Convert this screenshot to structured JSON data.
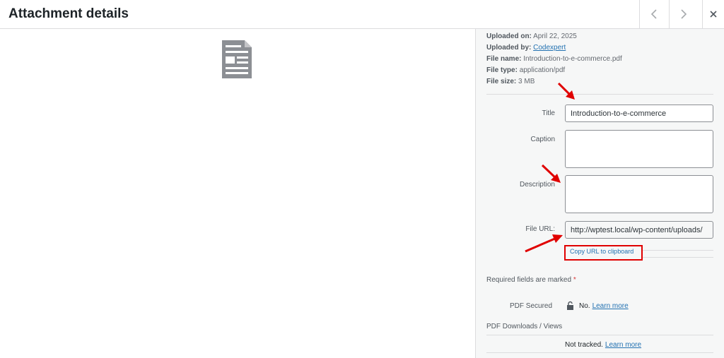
{
  "header": {
    "title": "Attachment details",
    "prev_icon": "chevron-left-icon",
    "next_icon": "chevron-right-icon",
    "close_icon": "close-icon"
  },
  "preview": {
    "icon": "document-icon"
  },
  "meta": {
    "uploaded_on_label": "Uploaded on:",
    "uploaded_on": "April 22, 2025",
    "uploaded_by_label": "Uploaded by:",
    "uploaded_by": "Codexpert",
    "file_name_label": "File name:",
    "file_name": "Introduction-to-e-commerce.pdf",
    "file_type_label": "File type:",
    "file_type": "application/pdf",
    "file_size_label": "File size:",
    "file_size": "3 MB"
  },
  "form": {
    "title_label": "Title",
    "title_value": "Introduction-to-e-commerce",
    "caption_label": "Caption",
    "caption_value": "",
    "description_label": "Description",
    "description_value": "",
    "file_url_label": "File URL:",
    "file_url_value": "http://wptest.local/wp-content/uploads/",
    "copy_url_label": "Copy URL to clipboard"
  },
  "required": {
    "text": "Required fields are marked",
    "star": "*"
  },
  "pdf": {
    "secured_label": "PDF Secured",
    "secured_value": "No.",
    "learn_more": "Learn more",
    "downloads_label": "PDF Downloads / Views",
    "tracked_value": "Not tracked.",
    "learn_more_2": "Learn more",
    "lock_icon": "lock-icon"
  },
  "colors": {
    "accent": "#2271b1",
    "annotation": "#e00000"
  }
}
